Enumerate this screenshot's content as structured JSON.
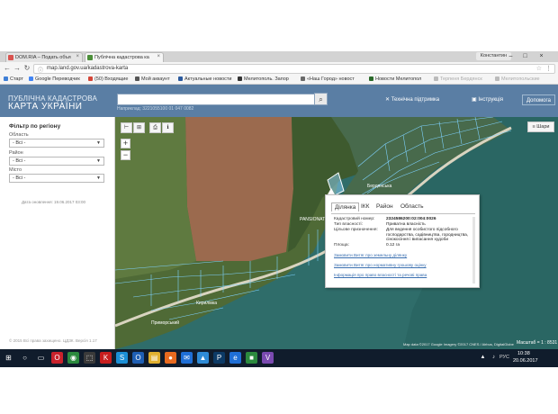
{
  "browser": {
    "tabs": [
      {
        "label": "DOM.RIA – Подать объя",
        "active": false,
        "favicon_color": "#d9534f"
      },
      {
        "label": "Публічна кадастрова ка",
        "active": true,
        "favicon_color": "#4c8f3a"
      }
    ],
    "user": "Константин",
    "url": "map.land.gov.ua/kadastrova-karta",
    "bookmarks": [
      {
        "label": "Старт",
        "color": "#3f7fd6"
      },
      {
        "label": "Google Переводчик",
        "color": "#4285f4"
      },
      {
        "label": "(50) Входящие",
        "color": "#d44638"
      },
      {
        "label": "Мой аккаунт",
        "color": "#555555"
      },
      {
        "label": "Актуальные новости",
        "color": "#2b5a9e"
      },
      {
        "label": "Мелитополь. Запор",
        "color": "#333333"
      },
      {
        "label": "«Наш Город» новост",
        "color": "#6a6a6a"
      },
      {
        "label": "Новости Мелитопол",
        "color": "#2a6a2a"
      },
      {
        "label": "Терпеня Бердянск",
        "color": "#999999"
      },
      {
        "label": "Мелитопольские",
        "color": "#999999"
      }
    ]
  },
  "app": {
    "title_line1": "ПУБЛІЧНА КАДАСТРОВА",
    "title_line2": "КАРТА УКРАЇНИ",
    "search_placeholder": "",
    "search_hint": "Наприклад: 3221055100 01 047 0082",
    "header_buttons": {
      "support": "Технічна підтримка",
      "manual": "Інструкція",
      "help": "Допомога"
    }
  },
  "sidebar": {
    "filter_title": "Фільтр по регіону",
    "fields": [
      {
        "label": "Область",
        "value": "- Всі -"
      },
      {
        "label": "Район",
        "value": "- Всі -"
      },
      {
        "label": "Місто",
        "value": "- Всі -"
      }
    ],
    "update_date": "Дата оновлення: 19.06.2017 03:00",
    "copyright": "© 2015 Всі права захищено. ЦДЗК. Версія 1.17"
  },
  "map": {
    "tools": {
      "measure": "⊢",
      "area": "⊞",
      "print": "⎙",
      "info": "ℹ"
    },
    "layers_label": "Шари",
    "zoom_in": "+",
    "zoom_out": "−",
    "place_labels": [
      "PANSIONAT",
      "Кирилівка",
      "Приморський",
      "Бердянська"
    ],
    "attribution": "Map data ©2017 Google Imagery ©2017 CNES / Airbus, DigitalGlobe",
    "scale": "Масштаб = 1 : 8531",
    "colors": {
      "sea": "#2f6d6a",
      "field": "#9b6a4e",
      "green": "#4f6a36",
      "parcel_stroke": "#7fd3ff"
    }
  },
  "popup": {
    "tabs": [
      "Ділянка",
      "ІКК",
      "Район",
      "Область"
    ],
    "rows": [
      {
        "label": "Кадастровий номер:",
        "value": "2324586200:02:004:0026"
      },
      {
        "label": "Тип власності:",
        "value": "Приватна власність"
      },
      {
        "label": "Цільове призначення:",
        "value": "Для ведення особистого підсобного господарства, садівництва, городництва, сінокосіння і випасання худоби"
      },
      {
        "label": "Площа:",
        "value": "0.12 га"
      }
    ],
    "links": [
      "Замовити Витяг про земельну ділянку",
      "Замовити Витяг про нормативну грошову оцінку",
      "Інформація про право власності та речові права"
    ]
  },
  "taskbar": {
    "language": "РУС",
    "time": "10:38",
    "date": "20.06.2017",
    "apps": [
      {
        "name": "start",
        "color": "#101c2c",
        "glyph": "⊞"
      },
      {
        "name": "search",
        "color": "#101c2c",
        "glyph": "○"
      },
      {
        "name": "task-view",
        "color": "#101c2c",
        "glyph": "▭"
      },
      {
        "name": "opera",
        "color": "#c9222c",
        "glyph": "O"
      },
      {
        "name": "chrome",
        "color": "#2b8a3e",
        "glyph": "◉"
      },
      {
        "name": "app1",
        "color": "#3a3a3a",
        "glyph": "⬚"
      },
      {
        "name": "adobe",
        "color": "#c81e1e",
        "glyph": "K"
      },
      {
        "name": "skype",
        "color": "#1b8fd6",
        "glyph": "S"
      },
      {
        "name": "outlook",
        "color": "#1e5fb4",
        "glyph": "O"
      },
      {
        "name": "explorer",
        "color": "#e0b030",
        "glyph": "▤"
      },
      {
        "name": "firefox",
        "color": "#e86a1f",
        "glyph": "●"
      },
      {
        "name": "mail",
        "color": "#1f6fd6",
        "glyph": "✉"
      },
      {
        "name": "photos",
        "color": "#2e8bd6",
        "glyph": "▲"
      },
      {
        "name": "ps",
        "color": "#0c3a66",
        "glyph": "P"
      },
      {
        "name": "edge",
        "color": "#1f6fd6",
        "glyph": "e"
      },
      {
        "name": "app2",
        "color": "#2b8a3e",
        "glyph": "■"
      },
      {
        "name": "viber",
        "color": "#7a4ab0",
        "glyph": "V"
      }
    ]
  }
}
